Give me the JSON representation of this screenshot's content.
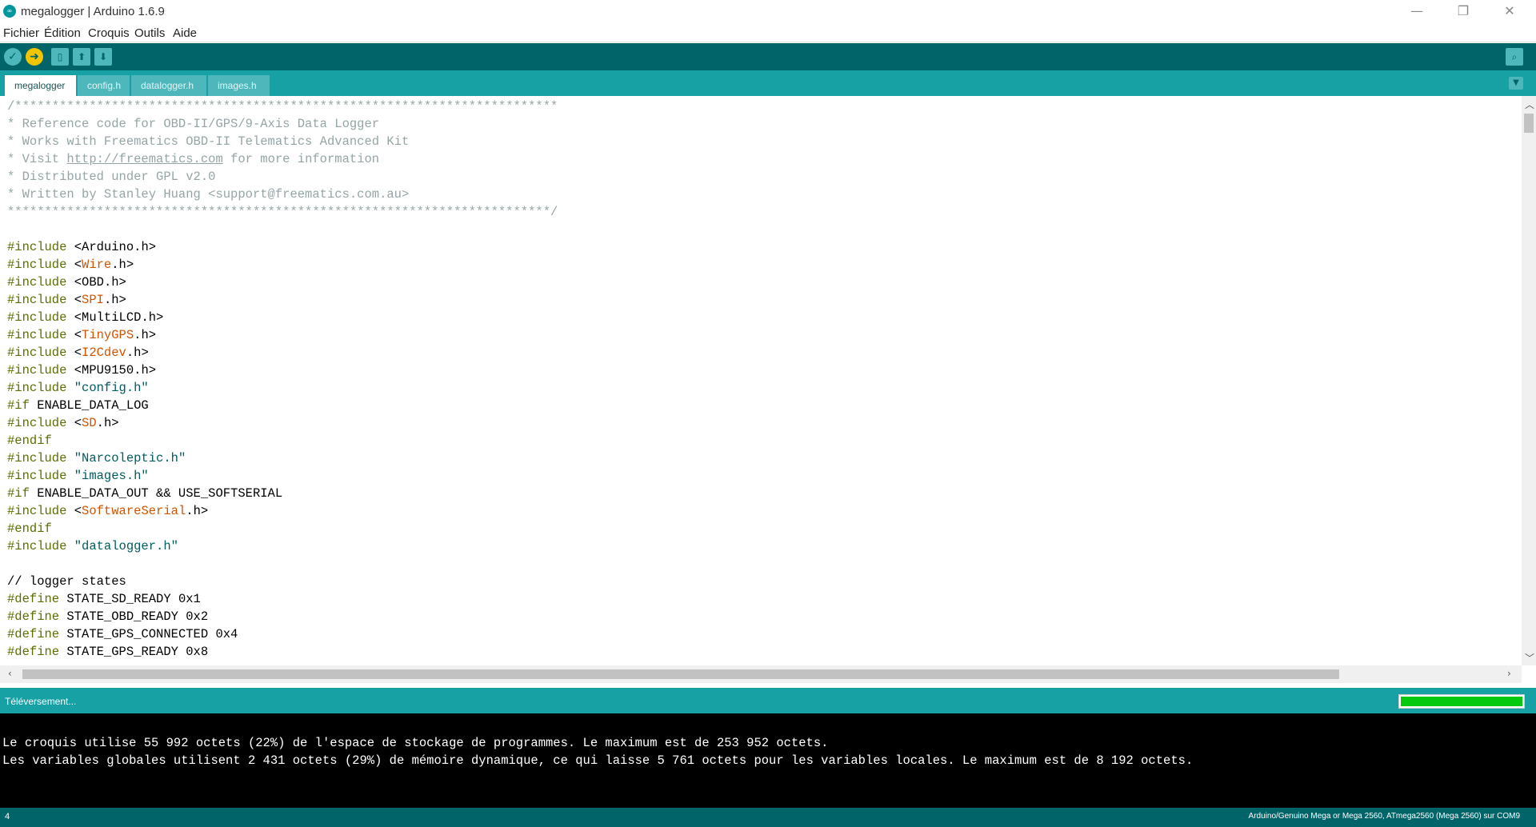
{
  "window": {
    "title": "megalogger | Arduino 1.6.9"
  },
  "menu": [
    "Fichier",
    "Édition",
    "Croquis",
    "Outils",
    "Aide"
  ],
  "tabs": [
    "megalogger",
    "config.h",
    "datalogger.h",
    "images.h"
  ],
  "toolbar_icons": [
    "verify-icon",
    "upload-icon",
    "new-icon",
    "open-icon",
    "save-icon",
    "serial-monitor-icon"
  ],
  "code": {
    "header": [
      "/*************************************************************************",
      "* Reference code for OBD-II/GPS/9-Axis Data Logger",
      "* Works with Freematics OBD-II Telematics Advanced Kit",
      "* Distributed under GPL v2.0",
      "* Written by Stanley Huang <support@freematics.com.au>",
      "*************************************************************************/"
    ],
    "visit": {
      "before": "* Visit ",
      "url": "http://freematics.com",
      "after": " for more information"
    },
    "includes": [
      {
        "d": "#include",
        "a": " <",
        "h": "Arduino",
        "b": ".h>",
        "hl": false
      },
      {
        "d": "#include",
        "a": " <",
        "h": "Wire",
        "b": ".h>",
        "hl": true
      },
      {
        "d": "#include",
        "a": " <",
        "h": "OBD",
        "b": ".h>",
        "hl": false
      },
      {
        "d": "#include",
        "a": " <",
        "h": "SPI",
        "b": ".h>",
        "hl": true
      },
      {
        "d": "#include",
        "a": " <",
        "h": "MultiLCD",
        "b": ".h>",
        "hl": false
      },
      {
        "d": "#include",
        "a": " <",
        "h": "TinyGPS",
        "b": ".h>",
        "hl": true
      },
      {
        "d": "#include",
        "a": " <",
        "h": "I2Cdev",
        "b": ".h>",
        "hl": true
      },
      {
        "d": "#include",
        "a": " <",
        "h": "MPU9150",
        "b": ".h>",
        "hl": false
      }
    ],
    "inc_config": {
      "d": "#include",
      "s": " \"config.h\""
    },
    "if1": {
      "d": "#if",
      "r": " ENABLE_DATA_LOG"
    },
    "inc_sd": {
      "d": "#include",
      "a": " <",
      "h": "SD",
      "b": ".h>"
    },
    "endif1": "#endif",
    "inc_narco": {
      "d": "#include",
      "s": " \"Narcoleptic.h\""
    },
    "inc_images": {
      "d": "#include",
      "s": " \"images.h\""
    },
    "if2": {
      "d": "#if",
      "r": " ENABLE_DATA_OUT && USE_SOFTSERIAL"
    },
    "inc_sw": {
      "d": "#include",
      "a": " <",
      "h": "SoftwareSerial",
      "b": ".h>"
    },
    "endif2": "#endif",
    "inc_dl": {
      "d": "#include",
      "s": " \"datalogger.h\""
    },
    "comment": "// logger states",
    "defines": [
      {
        "d": "#define",
        "r": " STATE_SD_READY 0x1"
      },
      {
        "d": "#define",
        "r": " STATE_OBD_READY 0x2"
      },
      {
        "d": "#define",
        "r": " STATE_GPS_CONNECTED 0x4"
      },
      {
        "d": "#define",
        "r": " STATE_GPS_READY 0x8"
      }
    ]
  },
  "status": {
    "text": "Téléversement...",
    "progress": 1.0
  },
  "console": [
    "Le croquis utilise 55 992 octets (22%) de l'espace de stockage de programmes. Le maximum est de 253 952 octets.",
    "Les variables globales utilisent 2 431 octets (29%) de mémoire dynamique, ce qui laisse 5 761 octets pour les variables locales. Le maximum est de 8 192 octets."
  ],
  "footer": {
    "line": "4",
    "board": "Arduino/Genuino Mega or Mega 2560, ATmega2560 (Mega 2560) sur COM9"
  }
}
